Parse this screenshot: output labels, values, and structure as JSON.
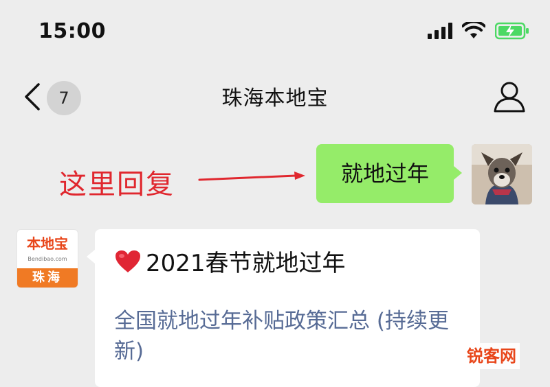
{
  "status_bar": {
    "time": "15:00",
    "icons": [
      "signal-icon",
      "wifi-icon",
      "battery-charging-icon"
    ]
  },
  "nav": {
    "back_icon": "chevron-left-icon",
    "badge_count": "7",
    "title": "珠海本地宝",
    "profile_icon": "person-icon"
  },
  "annotation": {
    "text": "这里回复"
  },
  "sent_message": {
    "text": "就地过年"
  },
  "received_message": {
    "title": "2021春节就地过年",
    "link_text": "全国就地过年补贴政策汇总 (持续更新)"
  },
  "bot_logo": {
    "top": "本地宝",
    "sub": "Bendibao.com",
    "bottom": "珠海"
  },
  "watermark": {
    "text": "锐客网"
  },
  "colors": {
    "sent_bubble": "#95ec69",
    "link": "#576b95",
    "annotation": "#e0272e",
    "logo_orange": "#f07a24"
  }
}
